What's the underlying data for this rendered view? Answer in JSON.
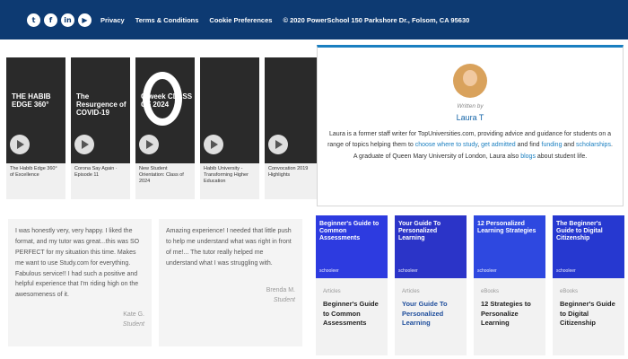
{
  "footer": {
    "social": [
      "t",
      "f",
      "in",
      "▶"
    ],
    "links": [
      "Privacy",
      "Terms & Conditions",
      "Cookie Preferences",
      "© 2020 PowerSchool 150 Parkshore Dr., Folsom, CA 95630"
    ]
  },
  "videos": [
    {
      "thumb_text": "THE HABIB EDGE 360°",
      "caption": "The Habib Edge 360° of Excellence"
    },
    {
      "thumb_text": "The Resurgence of COVID-19",
      "caption": "Corona Say Again · Episode 11"
    },
    {
      "thumb_text": "O'week CLASS OF 2024",
      "caption": "New Student Orientation: Class of 2024"
    },
    {
      "thumb_text": "",
      "caption": "Habib University - Transforming Higher Education"
    },
    {
      "thumb_text": "",
      "caption": "Convocation 2019 Highlights"
    }
  ],
  "author": {
    "written_by": "Written by",
    "name": "Laura T",
    "bio_1": "Laura is a former staff writer for TopUniversities.com, providing advice and guidance for students on a range of topics helping them to ",
    "bio_link_1": "choose where to study",
    "bio_2": ", ",
    "bio_link_2": "get admitted",
    "bio_3": " and find ",
    "bio_link_3": "funding",
    "bio_4": " and ",
    "bio_link_4": "scholarships",
    "bio_5": ". A graduate of Queen Mary University of London, Laura also ",
    "bio_link_5": "blogs",
    "bio_6": " about student life."
  },
  "testimonials": [
    {
      "text": "I was honestly very, very happy. I liked the format, and my tutor was great...this was SO PERFECT for my situation this time. Makes me want to use Study.com for everything. Fabulous service!! I had such a positive and helpful experience that I'm riding high on the awesomeness of it.",
      "name": "Kate G.",
      "role": "Student"
    },
    {
      "text": "Amazing experience! I needed that little push to help me understand what was right in front of me!... The tutor really helped me understand what I was struggling with.",
      "name": "Brenda M.",
      "role": "Student"
    }
  ],
  "resources": [
    {
      "image_text": "Beginner's Guide to Common Assessments",
      "brand": "schooleer",
      "tag": "Articles",
      "title": "Beginner's Guide to Common Assessments",
      "color": "#2d3be0"
    },
    {
      "image_text": "Your Guide To Personalized Learning",
      "brand": "schooleer",
      "tag": "Articles",
      "title": "Your Guide To Personalized Learning",
      "color": "#2b34c8"
    },
    {
      "image_text": "12 Personalized Learning Strategies",
      "brand": "schooleer",
      "tag": "eBooks",
      "title": "12 Strategies to Personalize Learning",
      "color": "#2e48e0"
    },
    {
      "image_text": "The Beginner's Guide to Digital Citizenship",
      "brand": "schooleer",
      "tag": "eBooks",
      "title": "Beginner's Guide to Digital Citizenship",
      "color": "#2638d0"
    }
  ]
}
